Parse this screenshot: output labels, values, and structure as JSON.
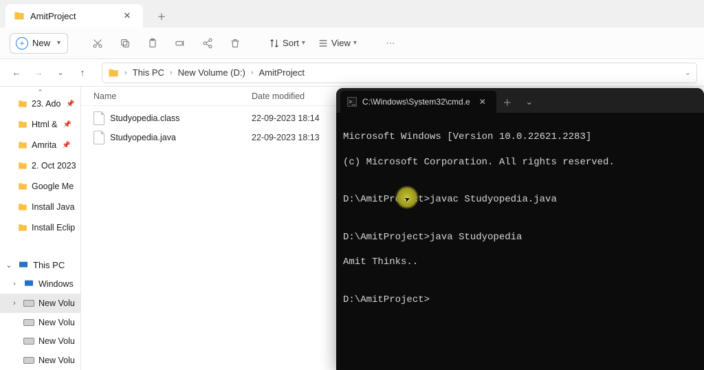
{
  "explorer": {
    "tab_title": "AmitProject",
    "toolbar": {
      "new_label": "New",
      "sort_label": "Sort",
      "view_label": "View"
    },
    "breadcrumb": {
      "a": "This PC",
      "b": "New Volume (D:)",
      "c": "AmitProject"
    },
    "columns": {
      "name": "Name",
      "date": "Date modified"
    },
    "files": [
      {
        "name": "Studyopedia.class",
        "date": "22-09-2023 18:14"
      },
      {
        "name": "Studyopedia.java",
        "date": "22-09-2023 18:13"
      }
    ],
    "quick": [
      "23. Ado",
      "Html &",
      "Amrita",
      "2. Oct 2023",
      "Google Me",
      "Install Java",
      "Install Eclip"
    ],
    "this_pc_label": "This PC",
    "drives": [
      "Windows",
      "New Volu",
      "New Volu",
      "New Volu",
      "New Volu"
    ]
  },
  "terminal": {
    "tab_title": "C:\\Windows\\System32\\cmd.e",
    "lines": {
      "l1": "Microsoft Windows [Version 10.0.22621.2283]",
      "l2": "(c) Microsoft Corporation. All rights reserved.",
      "l3": "",
      "l4": "D:\\AmitProject>javac Studyopedia.java",
      "l5": "",
      "l6": "D:\\AmitProject>java Studyopedia",
      "l7": "Amit Thinks..",
      "l8": "",
      "l9": "D:\\AmitProject>"
    }
  }
}
